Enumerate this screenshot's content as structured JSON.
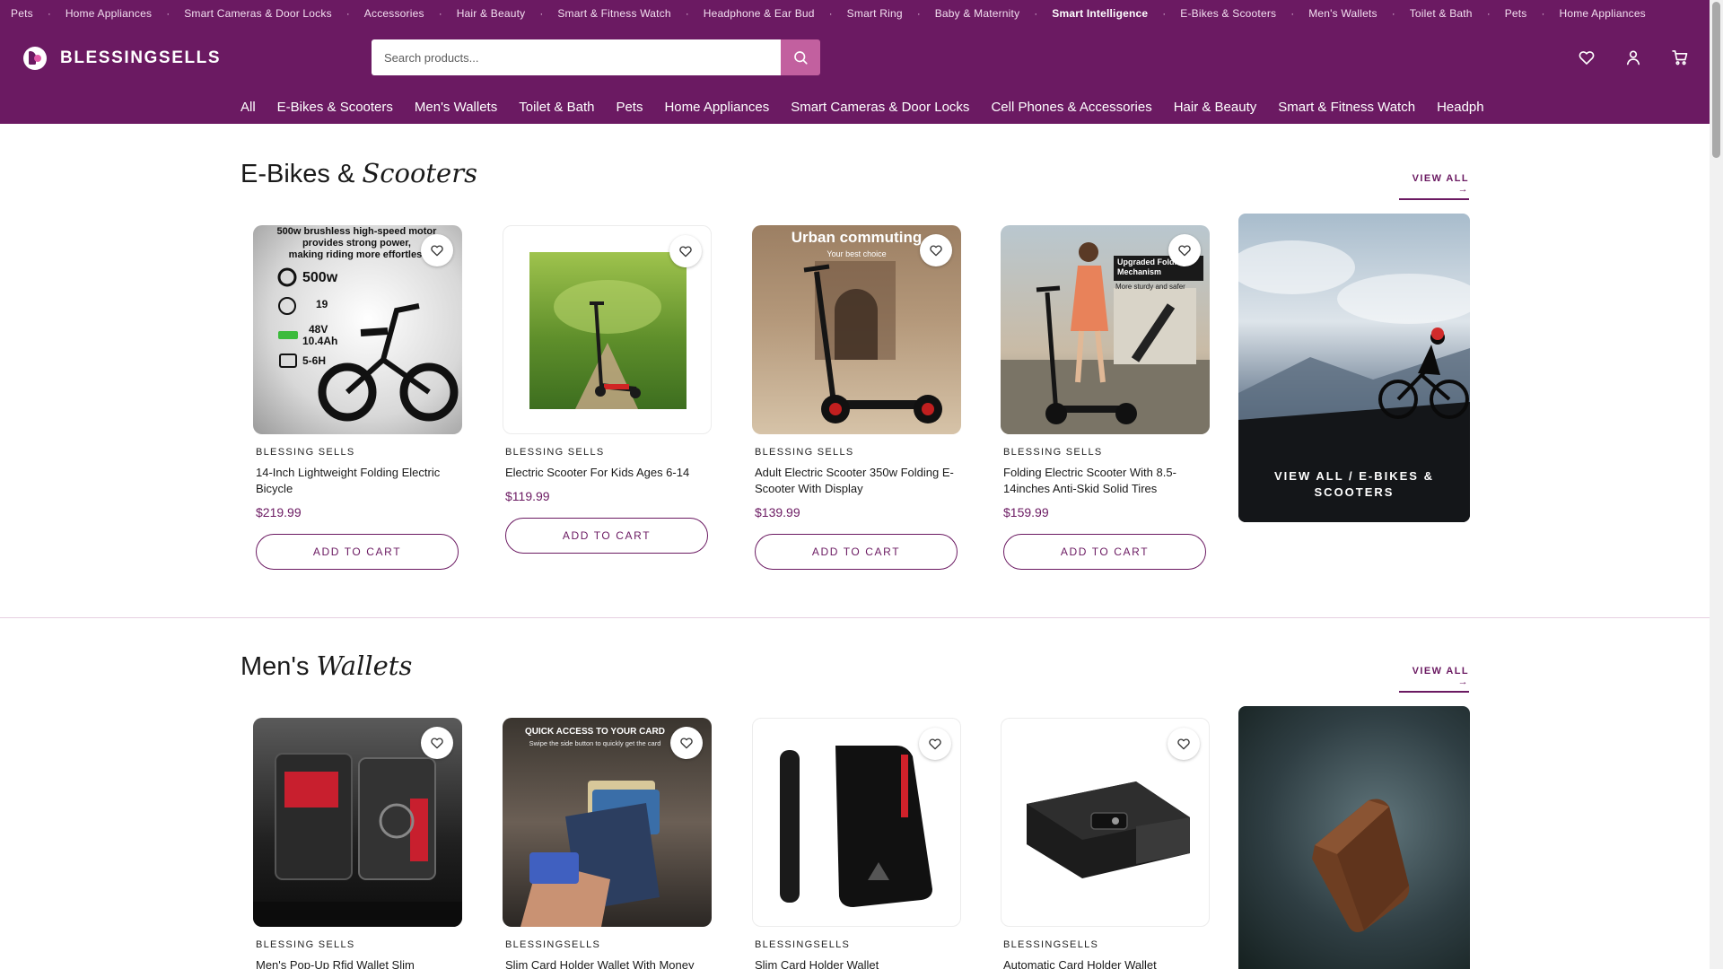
{
  "marquee": {
    "items": [
      {
        "label": "Pets",
        "bold": false
      },
      {
        "label": "Home Appliances",
        "bold": false
      },
      {
        "label": "Smart Cameras & Door Locks",
        "bold": false
      },
      {
        "label": "Accessories",
        "bold": false
      },
      {
        "label": "Hair & Beauty",
        "bold": false
      },
      {
        "label": "Smart & Fitness Watch",
        "bold": false
      },
      {
        "label": "Headphone & Ear Bud",
        "bold": false
      },
      {
        "label": "Smart Ring",
        "bold": false
      },
      {
        "label": "Baby & Maternity",
        "bold": false
      },
      {
        "label": "Smart Intelligence",
        "bold": true
      },
      {
        "label": "E-Bikes & Scooters",
        "bold": false
      },
      {
        "label": "Men's Wallets",
        "bold": false
      },
      {
        "label": "Toilet & Bath",
        "bold": false
      },
      {
        "label": "Pets",
        "bold": false
      },
      {
        "label": "Home Appliances",
        "bold": false
      }
    ],
    "separator": "·"
  },
  "header": {
    "logo_text": "BLESSINGSELLS",
    "search_placeholder": "Search products...",
    "icons": [
      "heart-icon",
      "user-icon",
      "cart-icon"
    ]
  },
  "catnav": [
    "All",
    "E-Bikes & Scooters",
    "Men's Wallets",
    "Toilet & Bath",
    "Pets",
    "Home Appliances",
    "Smart Cameras & Door Locks",
    "Cell Phones & Accessories",
    "Hair & Beauty",
    "Smart & Fitness Watch",
    "Headphone & Ear Bud"
  ],
  "sections": [
    {
      "title_plain": "E-Bikes & ",
      "title_italic": "Scooters",
      "view_all": "VIEW ALL →",
      "products": [
        {
          "brand": "BLESSING SELLS",
          "name": "14-Inch Lightweight Folding Electric Bicycle",
          "price": "$219.99",
          "cta": "ADD TO CART",
          "image": "ebike"
        },
        {
          "brand": "BLESSING SELLS",
          "name": "Electric Scooter For Kids Ages 6-14",
          "price": "$119.99",
          "cta": "ADD TO CART",
          "image": "kids-scooter"
        },
        {
          "brand": "BLESSING SELLS",
          "name": "Adult Electric Scooter 350w Folding E-Scooter With Display",
          "price": "$139.99",
          "cta": "ADD TO CART",
          "image": "urban-scooter"
        },
        {
          "brand": "BLESSING SELLS",
          "name": "Folding Electric Scooter With 8.5-14inches Anti-Skid Solid Tires",
          "price": "$159.99",
          "cta": "ADD TO CART",
          "image": "woman-scooter"
        }
      ],
      "promo_label": "VIEW ALL / E-BIKES & SCOOTERS"
    },
    {
      "title_plain": "Men's ",
      "title_italic": "Wallets",
      "view_all": "VIEW ALL →",
      "products": [
        {
          "brand": "BLESSING SELLS",
          "name": "Men's Pop-Up Rfid Wallet Slim",
          "image": "carbon-wallet"
        },
        {
          "brand": "BLESSINGSELLS",
          "name": "Slim Card Holder Wallet With Money",
          "image": "card-holder"
        },
        {
          "brand": "BLESSINGSELLS",
          "name": "Slim Card Holder Wallet",
          "image": "slim-wallet"
        },
        {
          "brand": "BLESSINGSELLS",
          "name": "Automatic Card Holder Wallet",
          "image": "auto-wallet"
        }
      ]
    }
  ],
  "image_text": {
    "ebike_headline": "500w brushless high-speed motor provides strong power, making riding more effortless",
    "ebike_specs": [
      "500w",
      "19",
      "48V 10.4Ah",
      "5-6H"
    ],
    "urban_title": "Urban commuting",
    "urban_sub": "Your best choice",
    "woman_badge_title": "Upgraded Folding Mechanism",
    "woman_badge_sub": "More sturdy and safer",
    "wallet2_title": "QUICK ACCESS TO YOUR CARD",
    "wallet2_sub": "Swipe the side button to quickly get the card"
  },
  "colors": {
    "brand_purple": "#6b1a62",
    "search_button": "#c2609f",
    "divider": "#e7cfe1"
  }
}
